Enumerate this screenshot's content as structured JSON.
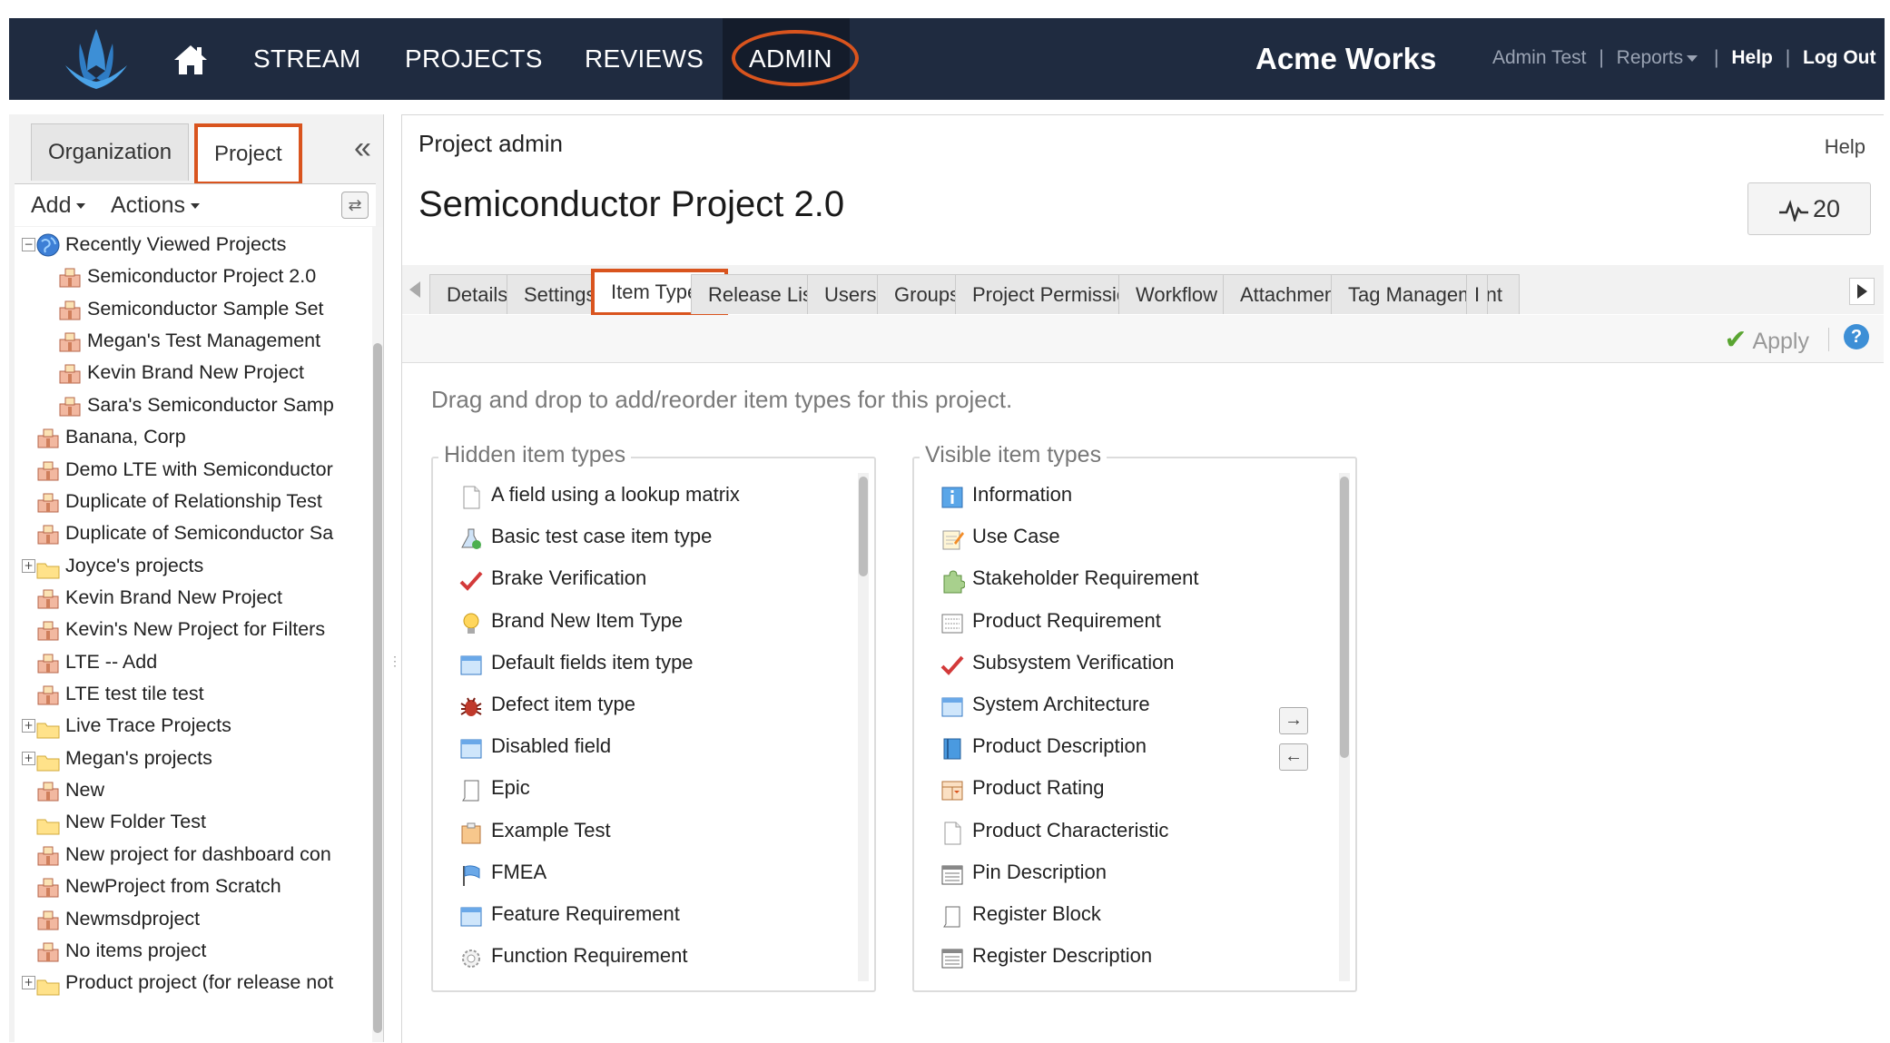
{
  "topnav": {
    "items": [
      "STREAM",
      "PROJECTS",
      "REVIEWS",
      "ADMIN"
    ],
    "brand": "Acme Works",
    "user": "Admin Test",
    "reports": "Reports",
    "help": "Help",
    "logout": "Log Out",
    "sep": "|"
  },
  "left_panel": {
    "tabs": [
      "Organization",
      "Project"
    ],
    "add_label": "Add",
    "actions_label": "Actions",
    "tree": [
      {
        "label": "Recently Viewed Projects",
        "level": 0,
        "icon": "globe-icon",
        "toggle": "−"
      },
      {
        "label": "Semiconductor Project 2.0",
        "level": 1,
        "icon": "project-icon"
      },
      {
        "label": "Semiconductor Sample Set",
        "level": 1,
        "icon": "project-icon"
      },
      {
        "label": "Megan's Test Management",
        "level": 1,
        "icon": "project-icon"
      },
      {
        "label": "Kevin Brand New Project",
        "level": 1,
        "icon": "project-icon"
      },
      {
        "label": "Sara's Semiconductor Samp",
        "level": 1,
        "icon": "project-icon"
      },
      {
        "label": "Banana, Corp",
        "level": 0,
        "icon": "project-icon"
      },
      {
        "label": "Demo LTE with Semiconductor",
        "level": 0,
        "icon": "project-icon"
      },
      {
        "label": "Duplicate of Relationship Test",
        "level": 0,
        "icon": "project-icon"
      },
      {
        "label": "Duplicate of Semiconductor Sa",
        "level": 0,
        "icon": "project-icon"
      },
      {
        "label": "Joyce's projects",
        "level": 0,
        "icon": "folder-icon",
        "toggle": "+"
      },
      {
        "label": "Kevin Brand New Project",
        "level": 0,
        "icon": "project-icon"
      },
      {
        "label": "Kevin's New Project for Filters",
        "level": 0,
        "icon": "project-icon"
      },
      {
        "label": "LTE -- Add",
        "level": 0,
        "icon": "project-icon"
      },
      {
        "label": "LTE test tile test",
        "level": 0,
        "icon": "project-icon"
      },
      {
        "label": "Live Trace Projects",
        "level": 0,
        "icon": "folder-icon",
        "toggle": "+"
      },
      {
        "label": "Megan's projects",
        "level": 0,
        "icon": "folder-icon",
        "toggle": "+"
      },
      {
        "label": "New",
        "level": 0,
        "icon": "project-icon"
      },
      {
        "label": "New Folder Test",
        "level": 0,
        "icon": "folder-icon"
      },
      {
        "label": "New project for dashboard con",
        "level": 0,
        "icon": "project-icon"
      },
      {
        "label": "NewProject from Scratch",
        "level": 0,
        "icon": "project-icon"
      },
      {
        "label": "Newmsdproject",
        "level": 0,
        "icon": "project-icon"
      },
      {
        "label": "No items project",
        "level": 0,
        "icon": "project-icon"
      },
      {
        "label": "Product project (for release not",
        "level": 0,
        "icon": "folder-icon",
        "toggle": "+"
      }
    ]
  },
  "main": {
    "breadcrumb": "Project admin",
    "help": "Help",
    "title": "Semiconductor Project 2.0",
    "activity_count": "20",
    "tabs": [
      "Details",
      "Settings",
      "Item Types",
      "Release List",
      "Users",
      "Groups",
      "Project Permissions",
      "Workflow",
      "Attachments",
      "Tag Management",
      "I"
    ],
    "active_tab": "Item Types",
    "apply_label": "Apply",
    "instructions": "Drag and drop to add/reorder item types for this project.",
    "hidden": {
      "legend": "Hidden item types",
      "items": [
        {
          "label": "A field using a lookup matrix",
          "icon": "document-icon"
        },
        {
          "label": "Basic test case item type",
          "icon": "flask-icon"
        },
        {
          "label": "Brake Verification",
          "icon": "checkmark-icon"
        },
        {
          "label": "Brand New Item Type",
          "icon": "lightbulb-icon"
        },
        {
          "label": "Default fields item type",
          "icon": "window-icon"
        },
        {
          "label": "Defect item type",
          "icon": "bug-icon"
        },
        {
          "label": "Disabled field",
          "icon": "window-icon"
        },
        {
          "label": "Epic",
          "icon": "page-icon"
        },
        {
          "label": "Example Test",
          "icon": "clipboard-icon"
        },
        {
          "label": "FMEA",
          "icon": "flag-icon"
        },
        {
          "label": "Feature Requirement",
          "icon": "window-icon"
        },
        {
          "label": "Function Requirement",
          "icon": "gear-icon"
        }
      ]
    },
    "visible": {
      "legend": "Visible item types",
      "items": [
        {
          "label": "Information",
          "icon": "info-icon"
        },
        {
          "label": "Use Case",
          "icon": "notepad-icon"
        },
        {
          "label": "Stakeholder Requirement",
          "icon": "puzzle-icon"
        },
        {
          "label": "Product Requirement",
          "icon": "form-icon"
        },
        {
          "label": "Subsystem Verification",
          "icon": "checkmark-icon"
        },
        {
          "label": "System Architecture",
          "icon": "window-icon"
        },
        {
          "label": "Product Description",
          "icon": "book-icon"
        },
        {
          "label": "Product Rating",
          "icon": "rating-icon"
        },
        {
          "label": "Product Characteristic",
          "icon": "document-icon"
        },
        {
          "label": "Pin Description",
          "icon": "list-icon"
        },
        {
          "label": "Register Block",
          "icon": "page-icon"
        },
        {
          "label": "Register Description",
          "icon": "list-icon"
        }
      ]
    }
  },
  "colors": {
    "nav_bg": "#1f2b40",
    "highlight": "#d9541e",
    "apply_check": "#5aa532",
    "help_blue": "#3d8fd6"
  }
}
